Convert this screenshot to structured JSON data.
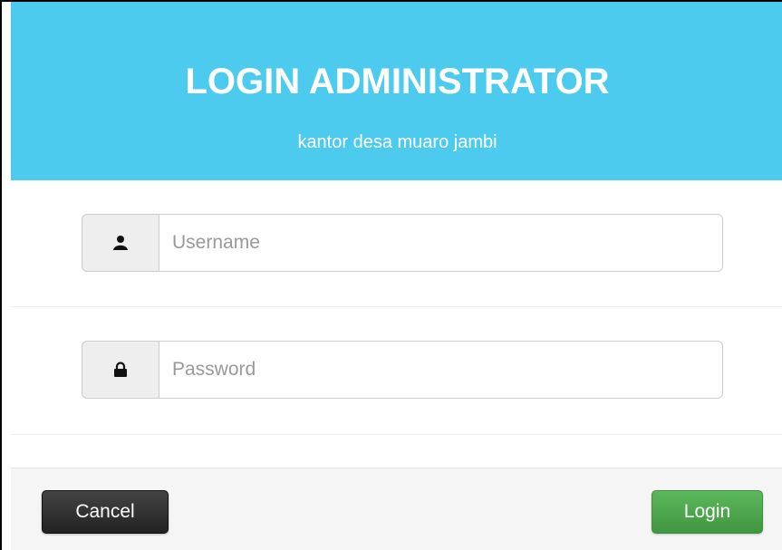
{
  "header": {
    "title": "LOGIN ADMINISTRATOR",
    "subtitle": "kantor desa muaro jambi"
  },
  "form": {
    "username": {
      "icon": "user-icon",
      "placeholder": "Username",
      "value": ""
    },
    "password": {
      "icon": "lock-icon",
      "placeholder": "Password",
      "value": ""
    }
  },
  "footer": {
    "cancel_label": "Cancel",
    "login_label": "Login"
  },
  "colors": {
    "header_bg": "#4ccbee",
    "cancel_bg": "#333333",
    "login_bg": "#4cae4c"
  }
}
